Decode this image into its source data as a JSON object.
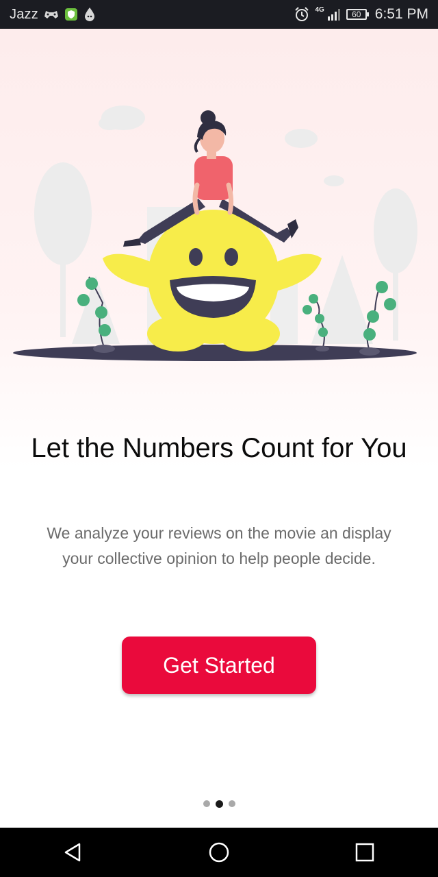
{
  "status_bar": {
    "carrier": "Jazz",
    "network_type": "4G",
    "battery_level": "60",
    "time": "6:51 PM",
    "icons": [
      "game-controller-icon",
      "shield-icon",
      "drop-icon",
      "alarm-icon",
      "signal-icon",
      "battery-icon"
    ]
  },
  "onboarding": {
    "headline": "Let the Numbers Count for You",
    "description": "We analyze your reviews on the movie an display your collective opinion to help people decide.",
    "cta_label": "Get Started",
    "page_indicator": {
      "total": 3,
      "active_index": 1
    }
  },
  "colors": {
    "accent": "#ea0a3c",
    "status_bar_bg": "#1b1c22",
    "nav_bar_bg": "#000000",
    "headline": "#0b0b0b",
    "description": "#6b6b6b",
    "emoji_yellow": "#f7ec4a",
    "shirt_pink": "#f0636c",
    "plant_green": "#49b07d"
  },
  "nav_bar": {
    "buttons": [
      "back-icon",
      "home-icon",
      "recents-icon"
    ]
  }
}
